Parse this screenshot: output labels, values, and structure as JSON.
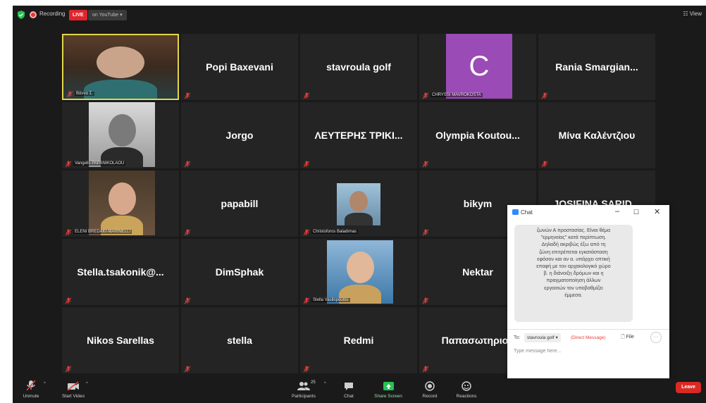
{
  "topbar": {
    "recording_label": "Recording",
    "live_label": "LIVE",
    "live_destination": "on YouTube",
    "view_label": "View"
  },
  "tiles": [
    {
      "name": "Βάννα Σ.",
      "type": "video"
    },
    {
      "name": "Popi Baxevani",
      "type": "name"
    },
    {
      "name": "stavroula golf",
      "type": "name"
    },
    {
      "name": "CHRYSSI MAVROKOSTA",
      "type": "letter",
      "letter": "C",
      "color": "#9b4bb5"
    },
    {
      "name": "Rania Smargian...",
      "type": "name"
    },
    {
      "name": "Vangelis PAPANIKOLAOU",
      "type": "photo"
    },
    {
      "name": "Jorgo",
      "type": "name"
    },
    {
      "name": "ΛΕΥΤΕΡΗΣ ΤΡΙΚΙ...",
      "type": "name"
    },
    {
      "name": "Olympia Koutou...",
      "type": "name"
    },
    {
      "name": "Μίνα Καλέντζιου",
      "type": "name"
    },
    {
      "name": "ELENI BREDAKI-MARINELLI",
      "type": "photo"
    },
    {
      "name": "papabill",
      "type": "name"
    },
    {
      "name": "Christoforos Baladimas",
      "type": "photo"
    },
    {
      "name": "bikym",
      "type": "name"
    },
    {
      "name": "JOSIFINA SARID...",
      "type": "name"
    },
    {
      "name": "Stella.tsakonik@...",
      "type": "name"
    },
    {
      "name": "DimSphak",
      "type": "name"
    },
    {
      "name": "Stella Vasilopoulou",
      "type": "photo"
    },
    {
      "name": "Nektar",
      "type": "name"
    },
    {
      "name": "",
      "type": "blank"
    },
    {
      "name": "Nikos Sarellas",
      "type": "name"
    },
    {
      "name": "stella",
      "type": "name"
    },
    {
      "name": "Redmi",
      "type": "name"
    },
    {
      "name": "Παπασωτηριου",
      "type": "name"
    },
    {
      "name": "",
      "type": "blank"
    }
  ],
  "chat": {
    "title": "Chat",
    "message_lines": [
      "ζωνών Α προστασίας. Είναι θέμα",
      "\"ερμηνείας\" κατά περίπτωση.",
      "Δηλαδή ακριβώς έξω από τη",
      "ζώνη επιτρέπεται εγκατάσταση",
      "εφόσον και αν α. υπάρχει οπτική",
      "επαφή με τον αρχαιολογικό χώρο",
      "β. η διάνοιξη δρόμων και η",
      "πραγματοποίηση άλλων",
      "εργασιών τον υποβαθμίζει",
      "έμμεσα."
    ],
    "to_label": "To:",
    "to_value": "stavroula golf",
    "direct_message": "(Direct Message)",
    "file_label": "File",
    "more_label": "···",
    "input_placeholder": "Type message here..."
  },
  "toolbar": {
    "unmute": "Unmute",
    "start_video": "Start Video",
    "participants": "Participants",
    "participants_count": "25",
    "chat": "Chat",
    "share_screen": "Share Screen",
    "record": "Record",
    "reactions": "Reactions",
    "leave": "Leave"
  },
  "colors": {
    "share_green": "#23c552",
    "leave_red": "#d92a24",
    "live_red": "#e0252c",
    "active_border": "#e3d64a",
    "muted_mic": "#e0413f"
  }
}
